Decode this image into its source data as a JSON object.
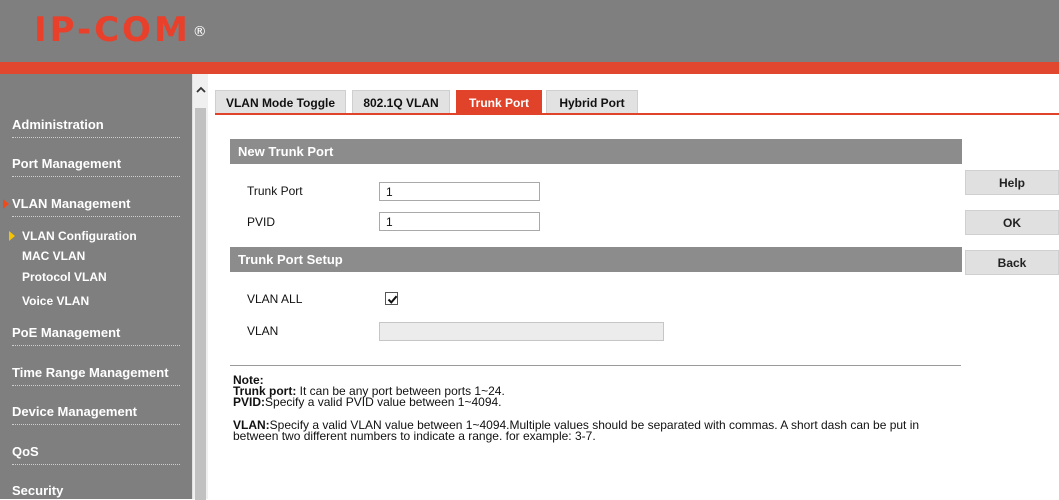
{
  "brand": {
    "logo_text": "IP-COM",
    "logo_mark": "®"
  },
  "colors": {
    "accent": "#e0432a",
    "sidebar_bg": "#7f7f7f",
    "section_bg": "#8c8c8c",
    "button_bg": "#e0e0e0"
  },
  "sidebar": {
    "items": [
      {
        "label": "Administration"
      },
      {
        "label": "Port Management"
      },
      {
        "label": "VLAN Management",
        "active": true
      },
      {
        "label": "PoE Management"
      },
      {
        "label": "Time Range Management"
      },
      {
        "label": "Device Management"
      },
      {
        "label": "QoS"
      },
      {
        "label": "Security"
      }
    ],
    "subitems": [
      {
        "label": "VLAN Configuration",
        "active": true
      },
      {
        "label": "MAC VLAN"
      },
      {
        "label": "Protocol VLAN"
      },
      {
        "label": "Voice VLAN"
      }
    ]
  },
  "tabs": [
    {
      "label": "VLAN Mode Toggle"
    },
    {
      "label": "802.1Q VLAN"
    },
    {
      "label": "Trunk Port",
      "active": true
    },
    {
      "label": "Hybrid Port"
    }
  ],
  "new_trunk": {
    "title": "New Trunk Port",
    "trunk_port_label": "Trunk Port",
    "trunk_port_value": "1",
    "pvid_label": "PVID",
    "pvid_value": "1"
  },
  "setup": {
    "title": "Trunk Port Setup",
    "vlan_all_label": "VLAN ALL",
    "vlan_all_checked": true,
    "vlan_label": "VLAN",
    "vlan_value": ""
  },
  "note": {
    "title": "Note:",
    "trunk_key": "Trunk port:",
    "trunk_text": " It can be any port between ports 1~24.",
    "pvid_key": "PVID:",
    "pvid_text": "Specify a valid PVID value between 1~4094.",
    "vlan_key": "VLAN:",
    "vlan_text": "Specify a valid VLAN value between 1~4094.Multiple values should be separated with commas. A short dash can be put in between two different numbers to indicate a range. for example: 3-7."
  },
  "buttons": {
    "help": "Help",
    "ok": "OK",
    "back": "Back"
  }
}
